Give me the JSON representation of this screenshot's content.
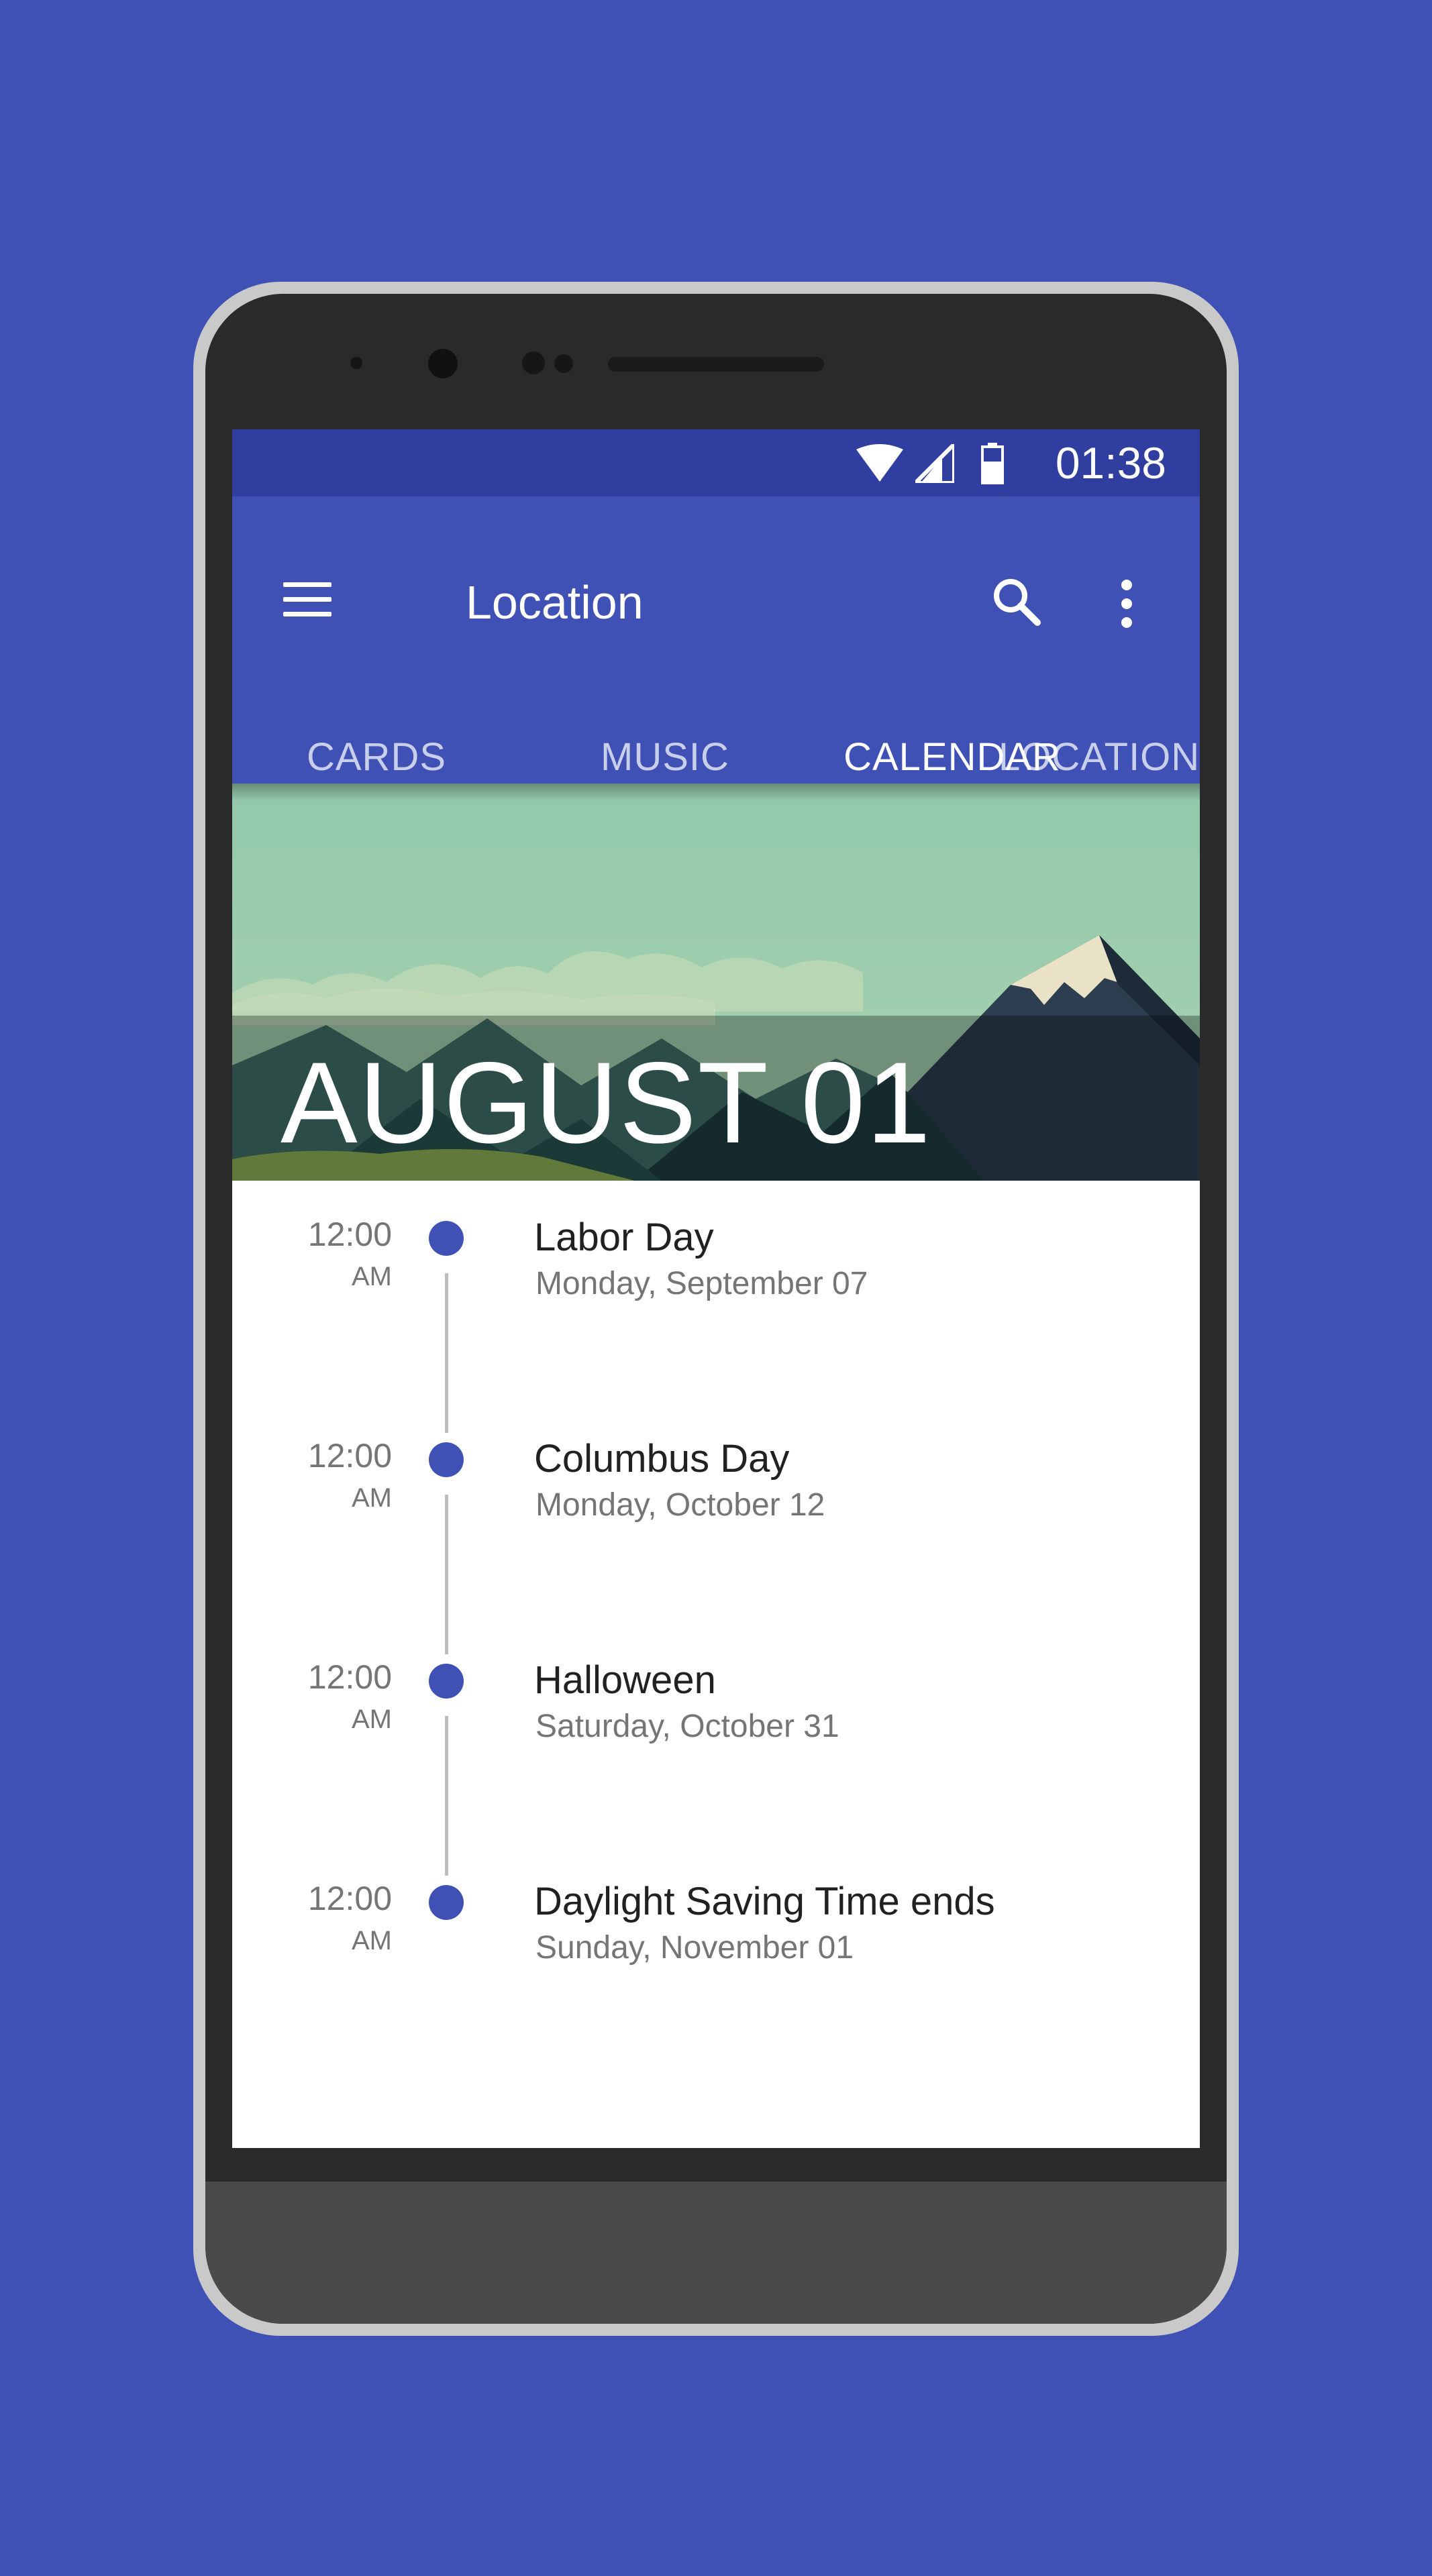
{
  "colors": {
    "background": "#3f51b5",
    "primary": "#3f51b5",
    "primary_dark": "#303f9f",
    "accent": "#ff4081",
    "timeline_dot": "#3f51b5"
  },
  "status_bar": {
    "time": "01:38",
    "icons": [
      "wifi-icon",
      "cell-signal-icon",
      "battery-icon"
    ]
  },
  "app_bar": {
    "title": "Location",
    "icons": [
      "menu-icon",
      "search-icon",
      "more-vert-icon"
    ]
  },
  "tabs": [
    {
      "label": "CARDS",
      "active": false
    },
    {
      "label": "MUSIC",
      "active": false
    },
    {
      "label": "CALENDAR",
      "active": true
    },
    {
      "label": "LOCATION",
      "active": false
    }
  ],
  "hero": {
    "date": "AUGUST 01"
  },
  "events": [
    {
      "time": "12:00",
      "ampm": "AM",
      "title": "Labor Day",
      "date": "Monday, September 07"
    },
    {
      "time": "12:00",
      "ampm": "AM",
      "title": "Columbus Day",
      "date": "Monday, October 12"
    },
    {
      "time": "12:00",
      "ampm": "AM",
      "title": "Halloween",
      "date": "Saturday, October 31"
    },
    {
      "time": "12:00",
      "ampm": "AM",
      "title": "Daylight Saving Time ends",
      "date": "Sunday, November 01"
    }
  ]
}
